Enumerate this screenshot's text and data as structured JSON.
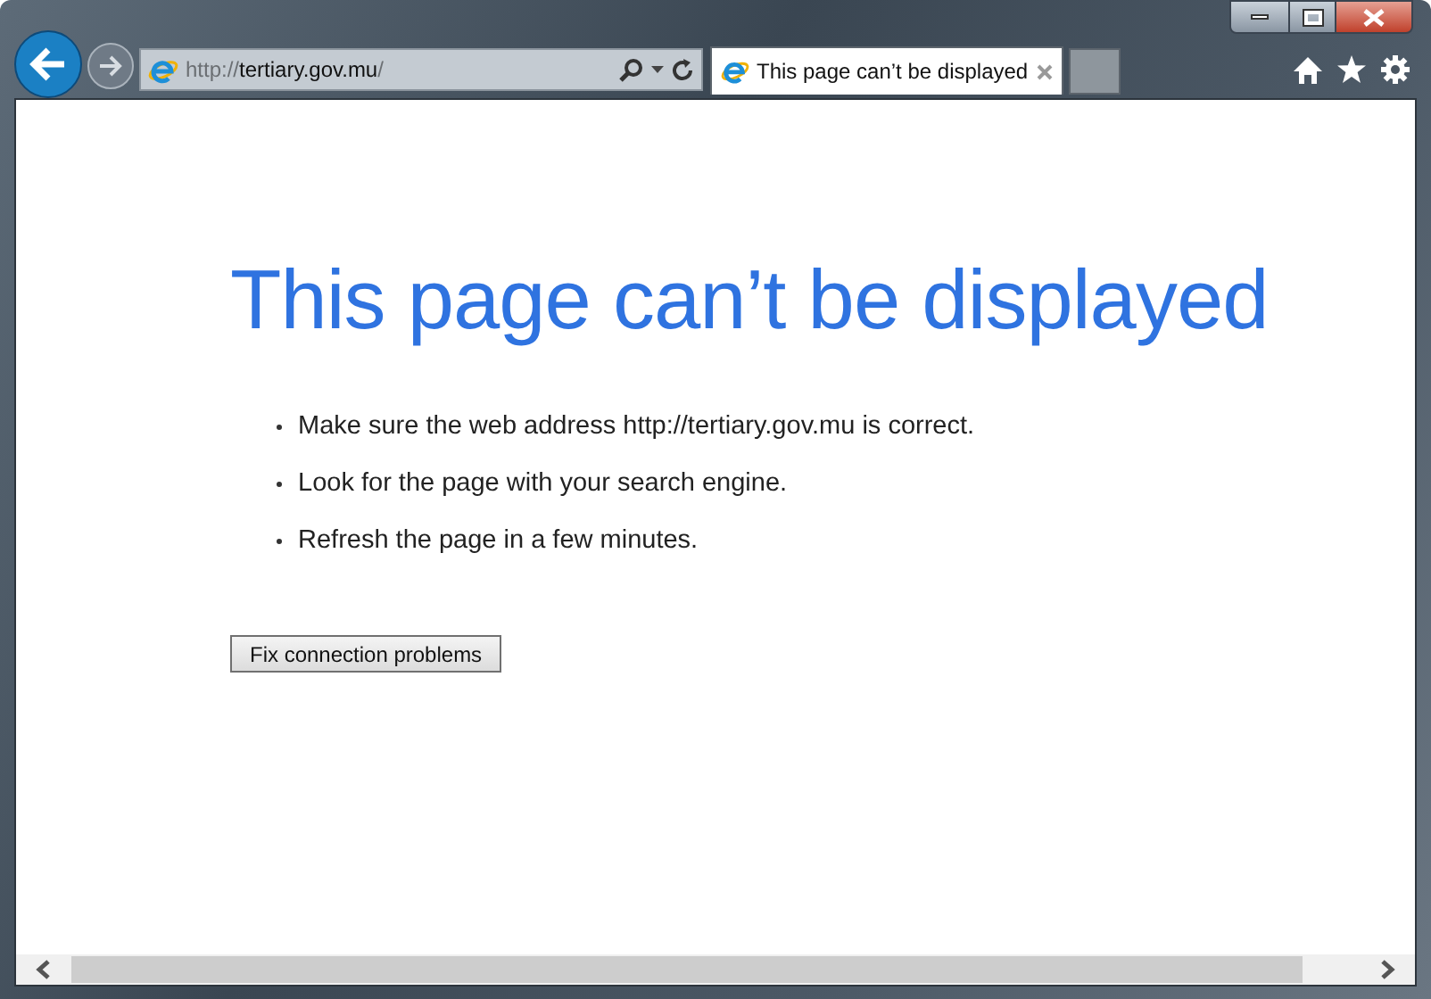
{
  "address_bar": {
    "scheme": "http://",
    "host": "tertiary.gov.mu",
    "path": "/"
  },
  "tabs": [
    {
      "title": "This page can’t be displayed",
      "selected": true
    }
  ],
  "page": {
    "heading": "This page can’t be displayed",
    "suggestions": [
      "Make sure the web address http://tertiary.gov.mu is correct.",
      "Look for the page with your search engine.",
      "Refresh the page in a few minutes."
    ],
    "button": "Fix connection problems"
  }
}
